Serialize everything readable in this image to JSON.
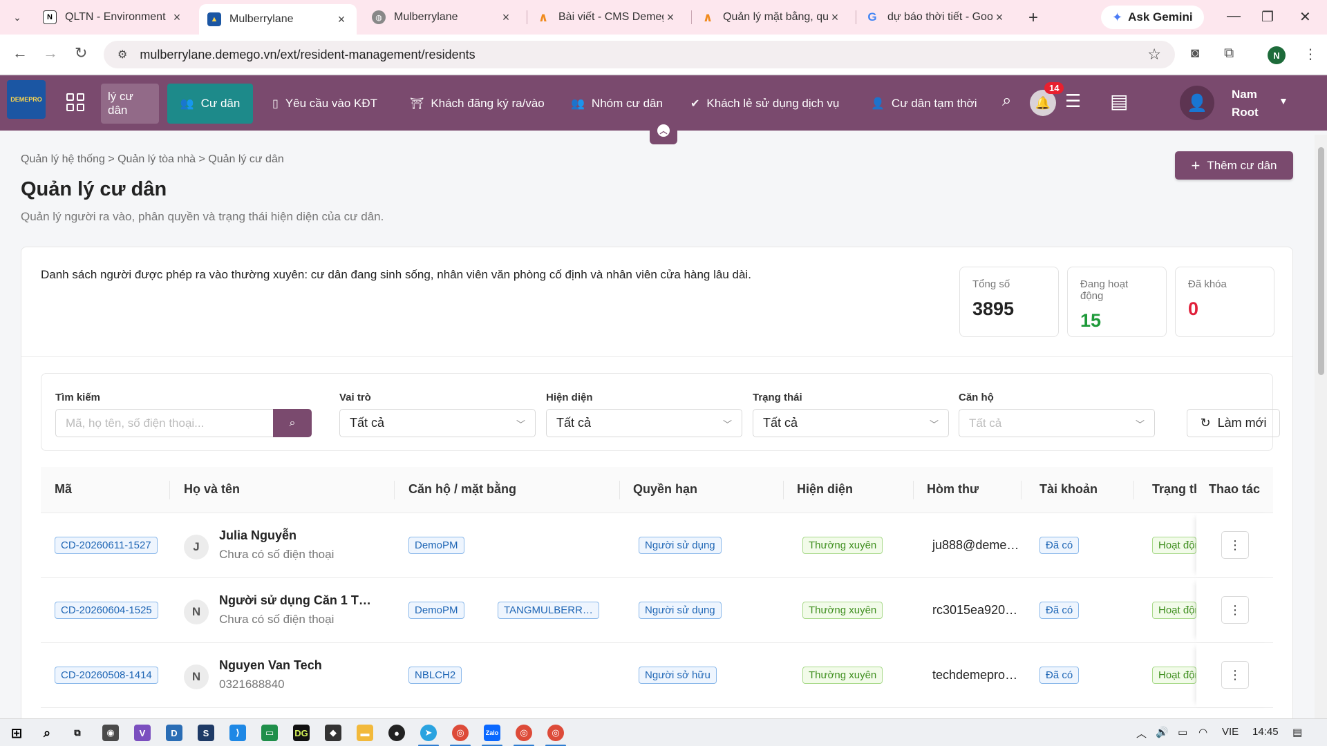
{
  "browser": {
    "tabs": [
      {
        "title": "QLTN - Environment",
        "icon": "notion-icon",
        "active": false
      },
      {
        "title": "Mulberrylane",
        "icon": "app-logo-icon",
        "active": true
      },
      {
        "title": "Mulberrylane",
        "icon": "globe-icon",
        "active": false
      },
      {
        "title": "Bài viết - CMS Demego",
        "icon": "cms-icon",
        "active": false
      },
      {
        "title": "Quản lý mặt bằng, quả",
        "icon": "cms-icon",
        "active": false
      },
      {
        "title": "dự báo thời tiết - Goo",
        "icon": "google-icon",
        "active": false
      }
    ],
    "gemini_label": "Ask Gemini",
    "url": "mulberrylane.demego.vn/ext/resident-management/residents",
    "profile_initial": "N"
  },
  "appbar": {
    "logo_text": "DEMEPRO",
    "nav": [
      {
        "label": "lý cư dân",
        "icon": "",
        "state": "first"
      },
      {
        "label": "Cư dân",
        "icon": "users-icon",
        "state": "selected"
      },
      {
        "label": "Yêu cầu vào KĐT",
        "icon": "phone-icon",
        "state": ""
      },
      {
        "label": "Khách đăng ký ra/vào",
        "icon": "gate-icon",
        "state": ""
      },
      {
        "label": "Nhóm cư dân",
        "icon": "group-icon",
        "state": ""
      },
      {
        "label": "Khách lẻ sử dụng dịch vụ",
        "icon": "user-check-icon",
        "state": ""
      },
      {
        "label": "Cư dân tạm thời",
        "icon": "user-icon",
        "state": ""
      }
    ],
    "notification_count": "14",
    "user": {
      "first": "Nam",
      "last": "Root"
    }
  },
  "page": {
    "breadcrumb": "Quản lý hệ thống > Quản lý tòa nhà > Quản lý cư dân",
    "title": "Quản lý cư dân",
    "subtitle": "Quản lý người ra vào, phân quyền và trạng thái hiện diện của cư dân.",
    "add_button": "Thêm cư dân"
  },
  "summary": {
    "description": "Danh sách người được phép ra vào thường xuyên: cư dân đang sinh sống, nhân viên văn phòng cố định và nhân viên cửa hàng lâu dài.",
    "stats": [
      {
        "label": "Tổng số",
        "value": "3895",
        "color": "#222222"
      },
      {
        "label": "Đang hoạt động",
        "value": "15",
        "color": "#1e9a3a"
      },
      {
        "label": "Đã khóa",
        "value": "0",
        "color": "#e0203a"
      }
    ]
  },
  "filters": {
    "search": {
      "label": "Tìm kiếm",
      "placeholder": "Mã, họ tên, số điện thoại..."
    },
    "role": {
      "label": "Vai trò",
      "value": "Tất cả"
    },
    "presence": {
      "label": "Hiện diện",
      "value": "Tất cả"
    },
    "status": {
      "label": "Trạng thái",
      "value": "Tất cả"
    },
    "apartment": {
      "label": "Căn hộ",
      "placeholder": "Tất cả"
    },
    "refresh_label": "Làm mới"
  },
  "table": {
    "headers": {
      "code": "Mã",
      "name": "Họ và tên",
      "apartment": "Căn hộ / mặt bằng",
      "permission": "Quyền hạn",
      "presence": "Hiện diện",
      "mailbox": "Hòm thư",
      "account": "Tài khoản",
      "status": "Trạng thái",
      "actions": "Thao tác"
    },
    "rows": [
      {
        "code": "CD-20260611-1527",
        "initial": "J",
        "name": "Julia Nguyễn",
        "phone": "Chưa có số điện thoại",
        "apartments": [
          "DemoPM"
        ],
        "permission": "Người sử dụng",
        "presence": "Thường xuyên",
        "email": "ju888@deme…",
        "account": "Đã có",
        "status": "Hoạt động"
      },
      {
        "code": "CD-20260604-1525",
        "initial": "N",
        "name": "Người sử dụng Căn 1 T…",
        "phone": "Chưa có số điện thoại",
        "apartments": [
          "DemoPM",
          "TANGMULBERR…"
        ],
        "permission": "Người sử dụng",
        "presence": "Thường xuyên",
        "email": "rc3015ea920…",
        "account": "Đã có",
        "status": "Hoạt động"
      },
      {
        "code": "CD-20260508-1414",
        "initial": "N",
        "name": "Nguyen Van Tech",
        "phone": "0321688840",
        "apartments": [
          "NBLCH2"
        ],
        "permission": "Người sở hữu",
        "presence": "Thường xuyên",
        "email": "techdemepro…",
        "account": "Đã có",
        "status": "Hoạt động"
      }
    ]
  },
  "taskbar": {
    "language": "VIE",
    "time": "14:45"
  }
}
